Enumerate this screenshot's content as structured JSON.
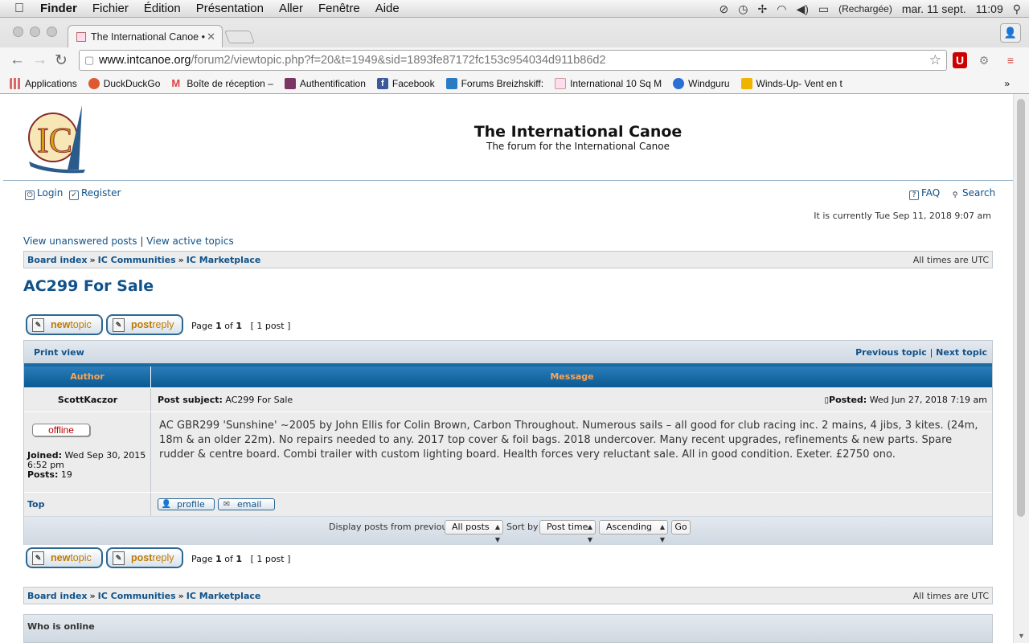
{
  "menubar": {
    "app": "Finder",
    "items": [
      "Fichier",
      "Édition",
      "Présentation",
      "Aller",
      "Fenêtre",
      "Aide"
    ],
    "battery": "(Rechargée)",
    "date": "mar. 11 sept.",
    "time": "11:09"
  },
  "browser": {
    "tab_title": "The International Canoe •",
    "url_host": "www.intcanoe.org",
    "url_path": "/forum2/viewtopic.php?f=20&t=1949&sid=1893fe87172fc153c954034d911b86d2",
    "bookmarks": [
      {
        "label": "Applications",
        "color": "#c77"
      },
      {
        "label": "DuckDuckGo",
        "color": "#de5833"
      },
      {
        "label": "Boîte de réception –",
        "color": "#d44"
      },
      {
        "label": "Authentification",
        "color": "#7a3566"
      },
      {
        "label": "Facebook",
        "color": "#3b5998"
      },
      {
        "label": "Forums Breizhskiff: ",
        "color": "#2a7ac6"
      },
      {
        "label": "International 10 Sq M",
        "color": "#c99"
      },
      {
        "label": "Windguru",
        "color": "#2b6fd6"
      },
      {
        "label": "Winds-Up- Vent en t",
        "color": "#f0b400"
      }
    ],
    "bookmarks_more": "»"
  },
  "site": {
    "title": "The International Canoe",
    "description": "The forum for the International Canoe",
    "login": "Login",
    "register": "Register",
    "faq": "FAQ",
    "search": "Search",
    "current_time": "It is currently Tue Sep 11, 2018 9:07 am",
    "unanswered": "View unanswered posts",
    "active": "View active topics",
    "divider": "|"
  },
  "breadcrumb": {
    "items": [
      "Board index",
      "IC Communities",
      "IC Marketplace"
    ],
    "sep": "»",
    "timezone": "All times are UTC"
  },
  "topic": {
    "title": "AC299 For Sale",
    "new_topic": "newtopic",
    "post_reply": "postreply",
    "page_label": "Page",
    "page": "1",
    "of": "of",
    "pages": "1",
    "post_count": "[ 1 post ]"
  },
  "table": {
    "print_view": "Print view",
    "prev_topic": "Previous topic",
    "next_topic": "Next topic",
    "col_author": "Author",
    "col_message": "Message"
  },
  "post": {
    "author": "ScottKaczor",
    "subject_label": "Post subject:",
    "subject": "AC299 For Sale",
    "posted_label": "Posted:",
    "posted": "Wed Jun 27, 2018 7:19 am",
    "status": "offline",
    "joined_label": "Joined:",
    "joined": "Wed Sep 30, 2015 6:52 pm",
    "posts_label": "Posts:",
    "posts": "19",
    "body": "AC GBR299 'Sunshine' ~2005 by John Ellis for Colin Brown, Carbon Throughout. Numerous sails – all good for club racing inc. 2 mains, 4 jibs, 3 kites. (24m, 18m & an older 22m). No repairs needed to any. 2017 top cover & foil bags. 2018 undercover. Many recent upgrades, refinements & new parts. Spare rudder & centre board. Combi trailer with custom lighting board. Health forces very reluctant sale. All in good condition. Exeter. £2750 ono.",
    "top": "Top",
    "profile": "profile",
    "email": "email"
  },
  "display": {
    "label": "Display posts from previous:",
    "all_posts": "All posts",
    "sort_by": "Sort by",
    "post_time": "Post time",
    "ascending": "Ascending",
    "go": "Go"
  },
  "who_online": "Who is online"
}
